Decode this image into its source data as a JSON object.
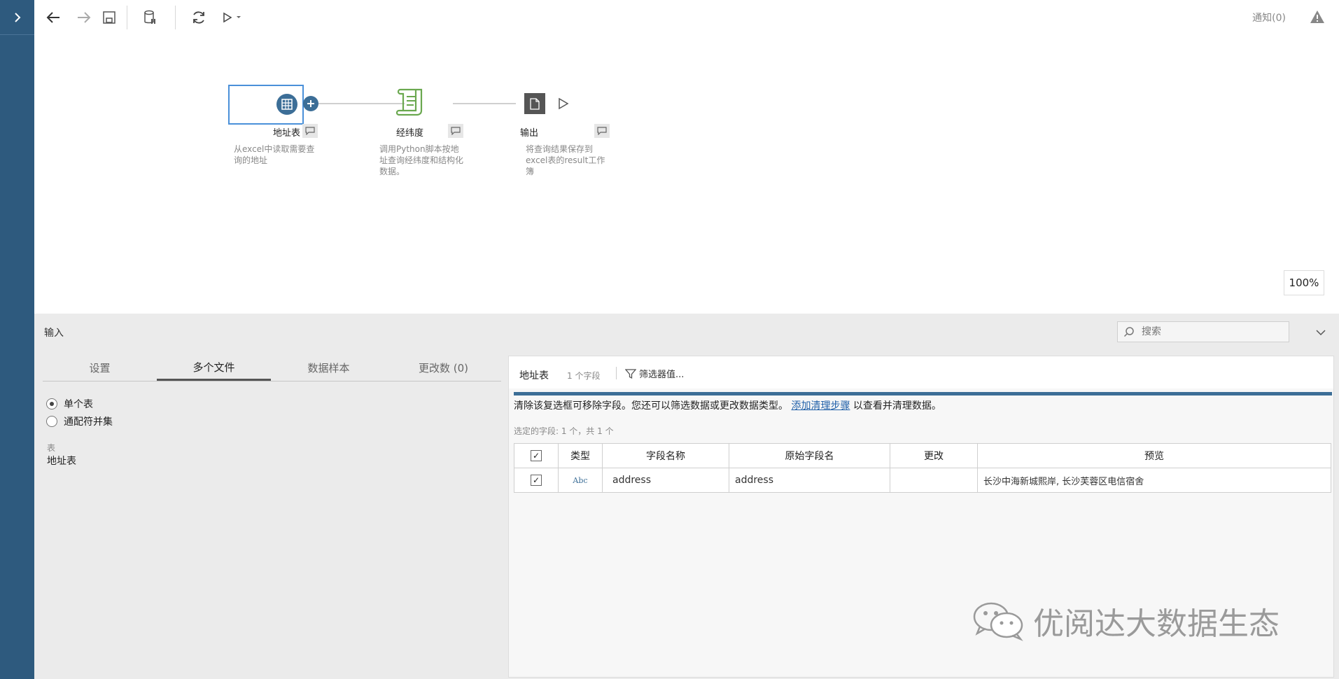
{
  "toolbar": {
    "notification_label": "通知(0)"
  },
  "flow": {
    "nodes": [
      {
        "label": "地址表",
        "description": "从excel中读取需要查询的地址"
      },
      {
        "label": "经纬度",
        "description": "调用Python脚本按地址查询经纬度和结构化数据。"
      },
      {
        "label": "输出",
        "description": "将查询结果保存到excel表的result工作簿"
      }
    ],
    "zoom": "100%"
  },
  "panel": {
    "title": "输入",
    "search_placeholder": "搜索",
    "tabs": [
      "设置",
      "多个文件",
      "数据样本",
      "更改数 (0)"
    ],
    "active_tab": 1,
    "radio_options": [
      "单个表",
      "通配符并集"
    ],
    "selected_radio": 0,
    "table_section_label": "表",
    "table_value": "地址表"
  },
  "fields_panel": {
    "table_name": "地址表",
    "field_count": "1 个字段",
    "filter_label": "筛选器值...",
    "info_text_before": "清除该复选框可移除字段。您还可以筛选数据或更改数据类型。",
    "info_link": "添加清理步骤",
    "info_text_after": "以查看并清理数据。",
    "selected_fields": "选定的字段: 1 个，共 1 个",
    "columns": [
      "类型",
      "字段名称",
      "原始字段名",
      "更改",
      "预览"
    ],
    "rows": [
      {
        "type": "Abc",
        "field_name": "address",
        "original_name": "address",
        "change": "",
        "preview": "长沙中海新城熙岸, 长沙芙蓉区电信宿舍"
      }
    ]
  },
  "watermark": "优阅达大数据生态",
  "colors": {
    "sidebar": "#2e5a7e",
    "accent": "#3c6e97",
    "node_green": "#6aa84f"
  }
}
